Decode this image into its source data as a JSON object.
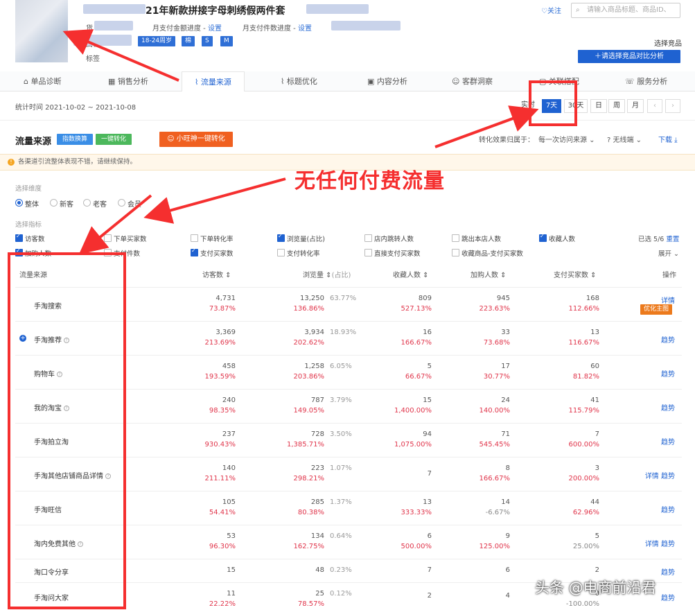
{
  "product": {
    "title_partial": "21年新款拼接字母刺绣假两件套",
    "goods_label": "货",
    "monthly_pay_amount_progress": "月支付金额进度 -",
    "monthly_pay_items_progress": "月支付件数进度 -",
    "set_link": "设置",
    "attr_label": "属性",
    "tags": [
      "18-24周岁",
      "棉",
      "S",
      "M"
    ],
    "mark_label": "标签",
    "follow": "关注",
    "search_placeholder": "请输入商品标题、商品ID、",
    "select_compare_label": "选择竞品",
    "compare_button": "请选择竞品对比分析"
  },
  "tabs": [
    "单品诊断",
    "销售分析",
    "流量来源",
    "标题优化",
    "内容分析",
    "客群洞察",
    "关联搭配",
    "服务分析"
  ],
  "active_tab": "流量来源",
  "date_bar": {
    "range": "统计时间 2021-10-02 ~ 2021-10-08",
    "buttons": [
      "实时",
      "7天",
      "30天",
      "日",
      "周",
      "月"
    ],
    "selected": "7天",
    "prev_icon": "‹",
    "next_icon": "›"
  },
  "panel": {
    "title": "流量来源",
    "btn_index": "指数换算",
    "btn_convert": "一键转化",
    "btn_xiaowang": "小旺神一键转化",
    "attribution_label": "转化效果归属于：",
    "attribution_value": "每一次访问来源",
    "device_value": "无线端",
    "download": "下载",
    "notice": "各渠道引流整体表现不错，请继续保持。",
    "dimension_label": "选择维度",
    "dimensions": [
      "整体",
      "新客",
      "老客",
      "会员"
    ],
    "metric_label": "选择指标",
    "metrics_row1": [
      {
        "label": "访客数",
        "on": true
      },
      {
        "label": "下单买家数",
        "on": false
      },
      {
        "label": "下单转化率",
        "on": false
      },
      {
        "label": "浏览量(占比)",
        "on": true
      },
      {
        "label": "店内跳转人数",
        "on": false
      },
      {
        "label": "跳出本店人数",
        "on": false
      },
      {
        "label": "收藏人数",
        "on": true
      }
    ],
    "metrics_row2": [
      {
        "label": "加购人数",
        "on": true
      },
      {
        "label": "支付件数",
        "on": false
      },
      {
        "label": "支付买家数",
        "on": true
      },
      {
        "label": "支付转化率",
        "on": false
      },
      {
        "label": "直接支付买家数",
        "on": false
      },
      {
        "label": "收藏商品-支付买家数",
        "on": false
      }
    ],
    "selected_count": "已选 5/6",
    "reset": "重置",
    "expand": "展开"
  },
  "table": {
    "headers": [
      "流量来源",
      "访客数",
      "浏览量",
      "(占比)",
      "收藏人数",
      "加购人数",
      "支付买家数",
      "操作"
    ],
    "rows": [
      {
        "source": "手淘搜索",
        "help": false,
        "plus": false,
        "visitors": "4,731",
        "visitors_pct": "73.87%",
        "views": "13,250",
        "views_pct": "136.86%",
        "share": "63.77%",
        "fav": "809",
        "fav_pct": "527.13%",
        "cart": "945",
        "cart_pct": "223.63%",
        "buyers": "168",
        "buyers_pct": "112.66%",
        "ops": "详情",
        "op_btn": "优化主图"
      },
      {
        "source": "手淘推荐",
        "help": true,
        "plus": true,
        "visitors": "3,369",
        "visitors_pct": "213.69%",
        "views": "3,934",
        "views_pct": "202.62%",
        "share": "18.93%",
        "fav": "16",
        "fav_pct": "166.67%",
        "cart": "33",
        "cart_pct": "73.68%",
        "buyers": "13",
        "buyers_pct": "116.67%",
        "ops": "趋势"
      },
      {
        "source": "购物车",
        "help": true,
        "plus": false,
        "visitors": "458",
        "visitors_pct": "193.59%",
        "views": "1,258",
        "views_pct": "203.86%",
        "share": "6.05%",
        "fav": "5",
        "fav_pct": "66.67%",
        "cart": "17",
        "cart_pct": "30.77%",
        "buyers": "60",
        "buyers_pct": "81.82%",
        "ops": "趋势"
      },
      {
        "source": "我的淘宝",
        "help": true,
        "plus": false,
        "visitors": "240",
        "visitors_pct": "98.35%",
        "views": "787",
        "views_pct": "149.05%",
        "share": "3.79%",
        "fav": "15",
        "fav_pct": "1,400.00%",
        "cart": "24",
        "cart_pct": "140.00%",
        "buyers": "41",
        "buyers_pct": "115.79%",
        "ops": "趋势"
      },
      {
        "source": "手淘拍立淘",
        "help": false,
        "plus": false,
        "visitors": "237",
        "visitors_pct": "930.43%",
        "views": "728",
        "views_pct": "1,385.71%",
        "share": "3.50%",
        "fav": "94",
        "fav_pct": "1,075.00%",
        "cart": "71",
        "cart_pct": "545.45%",
        "buyers": "7",
        "buyers_pct": "600.00%",
        "ops": "趋势"
      },
      {
        "source": "手淘其他店铺商品详情",
        "help": true,
        "plus": false,
        "visitors": "140",
        "visitors_pct": "211.11%",
        "views": "223",
        "views_pct": "298.21%",
        "share": "1.07%",
        "fav": "7",
        "fav_pct": "",
        "cart": "8",
        "cart_pct": "166.67%",
        "buyers": "3",
        "buyers_pct": "200.00%",
        "ops": "详情  趋势"
      },
      {
        "source": "手淘旺信",
        "help": false,
        "plus": false,
        "visitors": "105",
        "visitors_pct": "54.41%",
        "views": "285",
        "views_pct": "80.38%",
        "share": "1.37%",
        "fav": "13",
        "fav_pct": "333.33%",
        "cart": "14",
        "cart_pct": "-6.67%",
        "cart_neg": true,
        "buyers": "44",
        "buyers_pct": "62.96%",
        "ops": "趋势"
      },
      {
        "source": "淘内免费其他",
        "help": true,
        "plus": false,
        "visitors": "53",
        "visitors_pct": "96.30%",
        "views": "134",
        "views_pct": "162.75%",
        "share": "0.64%",
        "fav": "6",
        "fav_pct": "500.00%",
        "cart": "9",
        "cart_pct": "125.00%",
        "buyers": "5",
        "buyers_pct": "25.00%",
        "buyers_neg": true,
        "ops": "详情  趋势"
      },
      {
        "source": "淘口令分享",
        "help": false,
        "plus": false,
        "visitors": "15",
        "visitors_pct": "",
        "views": "48",
        "views_pct": "",
        "share": "0.23%",
        "fav": "7",
        "fav_pct": "",
        "cart": "6",
        "cart_pct": "",
        "buyers": "2",
        "buyers_pct": "",
        "ops": "趋势"
      },
      {
        "source": "手淘问大家",
        "help": false,
        "plus": false,
        "visitors": "11",
        "visitors_pct": "22.22%",
        "views": "25",
        "views_pct": "78.57%",
        "share": "0.12%",
        "fav": "2",
        "fav_pct": "",
        "cart": "4",
        "cart_pct": "",
        "buyers": "0",
        "buyers_pct": "-100.00%",
        "buyers_neg": true,
        "ops": "趋势"
      }
    ]
  },
  "annotations": {
    "headline": "无任何付费流量"
  },
  "watermark": "头条 @电商前沿君",
  "colors": {
    "accent": "#1f62d1",
    "red": "#f52f2f",
    "up": "#e0344a",
    "orange": "#ec7a1c"
  }
}
